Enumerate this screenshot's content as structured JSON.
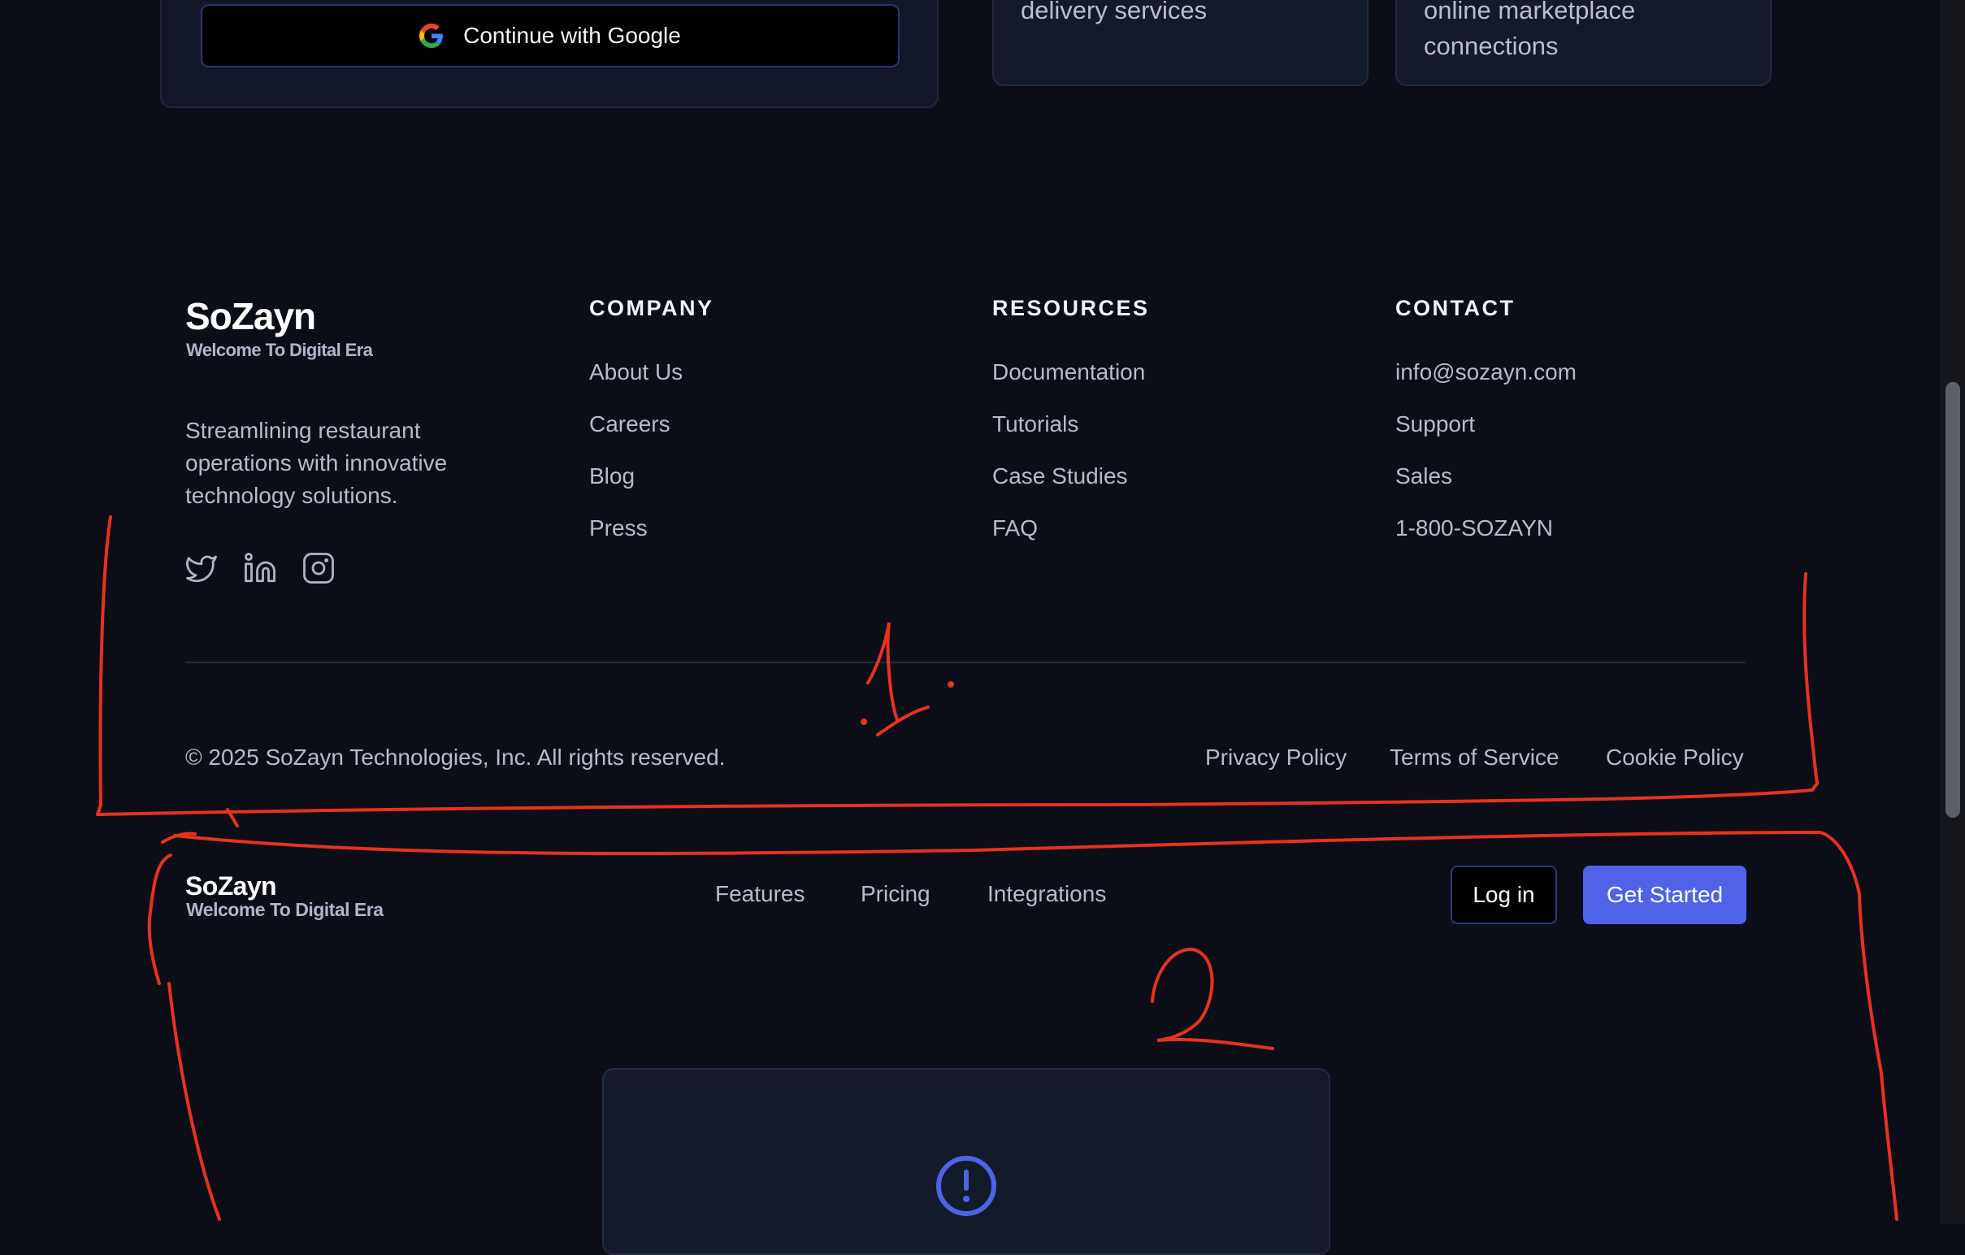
{
  "signup": {
    "google_label": "Continue with Google"
  },
  "feature_cards": [
    {
      "lines": [
        "delivery services"
      ]
    },
    {
      "lines": [
        "online marketplace",
        "connections"
      ]
    }
  ],
  "footer": {
    "brand": {
      "name": "SoZayn",
      "tagline": "Welcome To Digital Era"
    },
    "description": "Streamlining restaurant operations with innovative technology solutions.",
    "social": [
      "twitter-icon",
      "linkedin-icon",
      "instagram-icon"
    ],
    "columns": [
      {
        "heading": "COMPANY",
        "links": [
          "About Us",
          "Careers",
          "Blog",
          "Press"
        ]
      },
      {
        "heading": "RESOURCES",
        "links": [
          "Documentation",
          "Tutorials",
          "Case Studies",
          "FAQ"
        ]
      },
      {
        "heading": "CONTACT",
        "links": [
          "info@sozayn.com",
          "Support",
          "Sales",
          "1-800-SOZAYN"
        ]
      }
    ],
    "copyright": "© 2025 SoZayn Technologies, Inc. All rights reserved.",
    "legal": [
      "Privacy Policy",
      "Terms of Service",
      "Cookie Policy"
    ]
  },
  "navbar": {
    "brand": {
      "name": "SoZayn",
      "tagline": "Welcome To Digital Era"
    },
    "links": [
      "Features",
      "Pricing",
      "Integrations"
    ],
    "login_label": "Log in",
    "cta_label": "Get Started"
  },
  "annotations": {
    "first": "1.",
    "second": "2",
    "color": "#e8321e"
  },
  "colors": {
    "accent": "#4f63e8",
    "background": "#0b0e17",
    "card": "#131a2a"
  }
}
